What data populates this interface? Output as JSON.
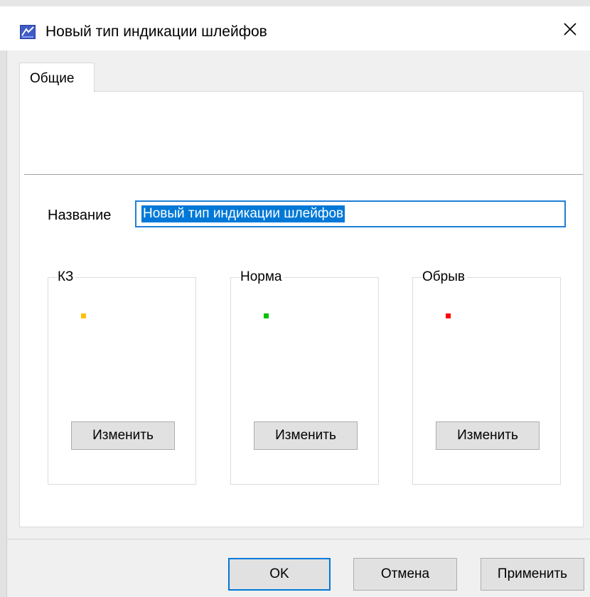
{
  "window": {
    "title": "Новый тип индикации шлейфов"
  },
  "tabs": [
    {
      "label": "Общие",
      "active": true
    }
  ],
  "form": {
    "name_label": "Название",
    "name_value": "Новый тип индикации шлейфов"
  },
  "states": [
    {
      "label": "КЗ",
      "indicator_color": "#ffc000",
      "button_label": "Изменить"
    },
    {
      "label": "Норма",
      "indicator_color": "#00c000",
      "button_label": "Изменить"
    },
    {
      "label": "Обрыв",
      "indicator_color": "#ff0000",
      "button_label": "Изменить"
    }
  ],
  "footer": {
    "ok_label": "OK",
    "cancel_label": "Отмена",
    "apply_label": "Применить"
  },
  "colors": {
    "accent": "#0078d7",
    "selection": "#0078d7"
  },
  "icons": {
    "app": "app-logo-icon",
    "close": "close-icon"
  }
}
